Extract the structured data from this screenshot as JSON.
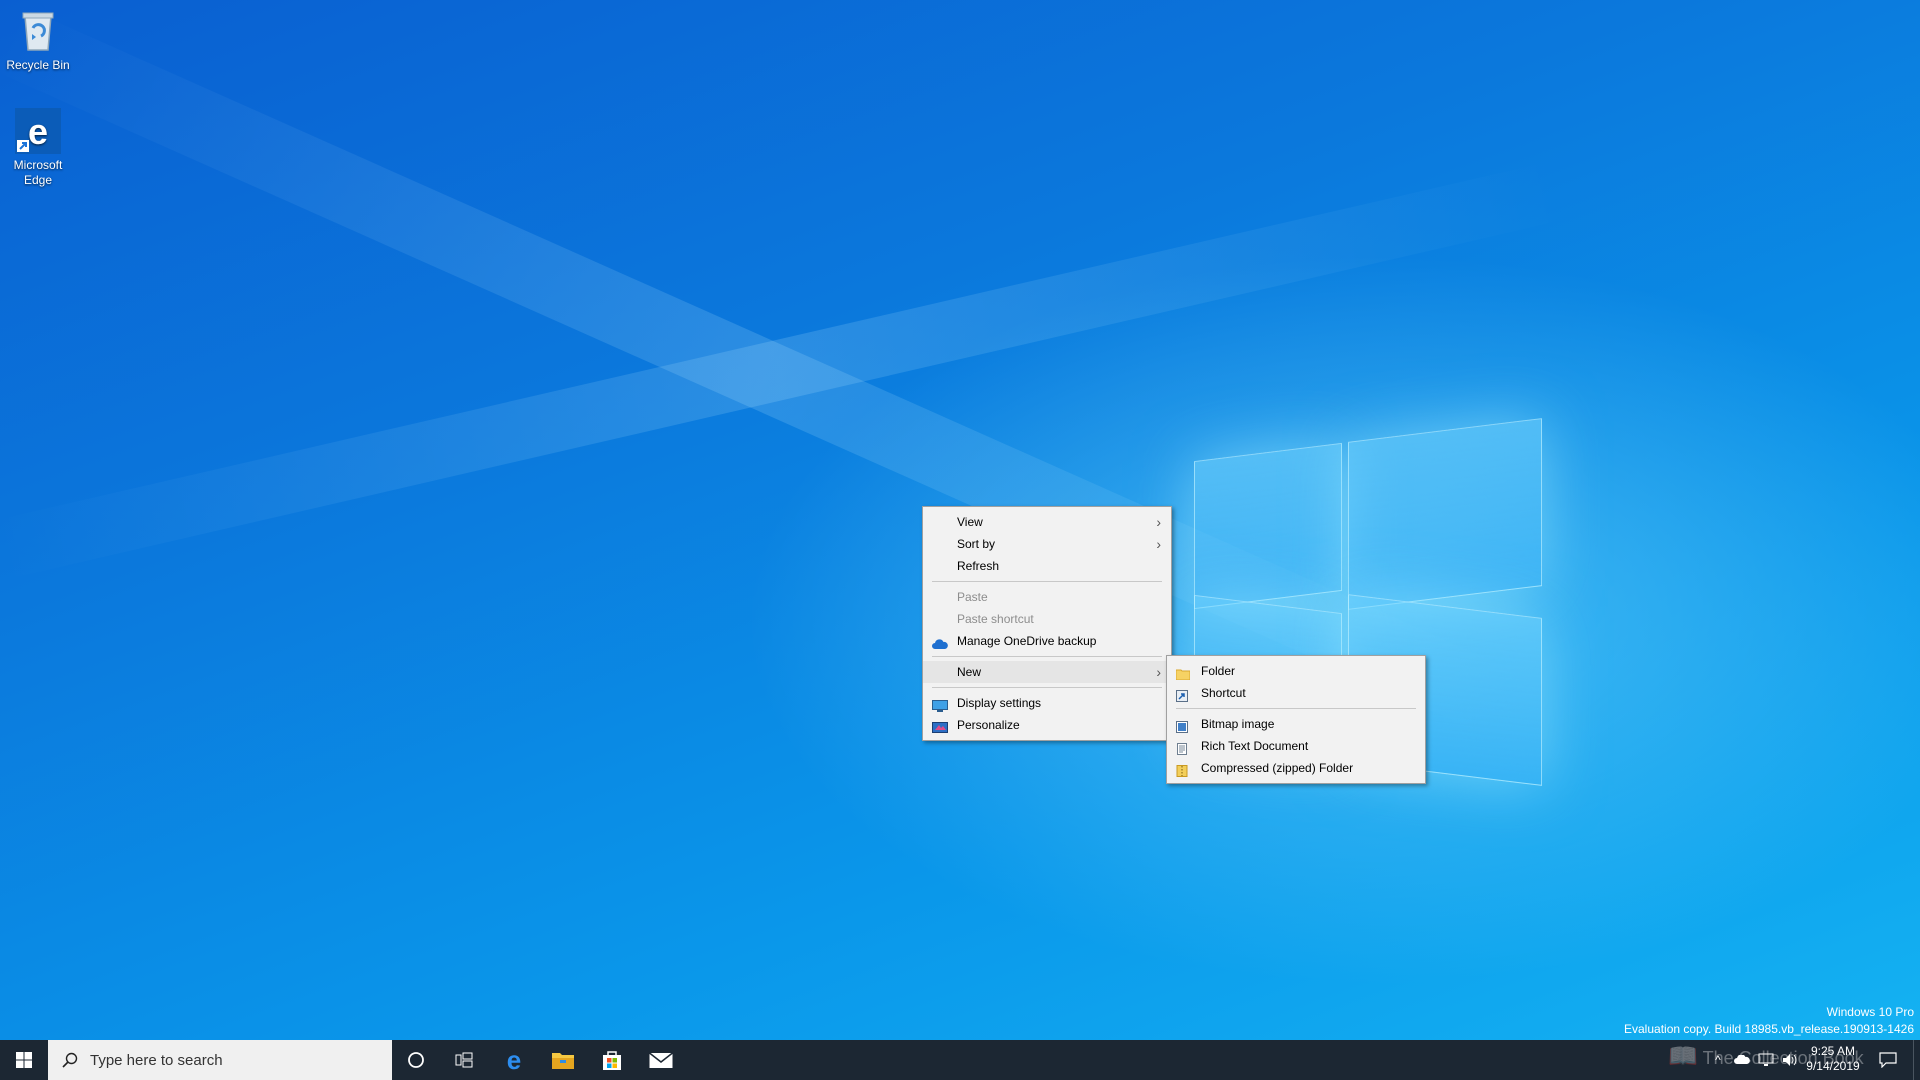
{
  "desktop": {
    "icons": [
      {
        "label": "Recycle Bin"
      },
      {
        "label": "Microsoft Edge"
      }
    ],
    "watermark": {
      "line1": "Windows 10 Pro",
      "line2": "Evaluation copy. Build 18985.vb_release.190913-1426"
    },
    "overlay_text": "The Collection Book"
  },
  "context_menu": {
    "items": [
      {
        "label": "View",
        "submenu": true
      },
      {
        "label": "Sort by",
        "submenu": true
      },
      {
        "label": "Refresh"
      },
      {
        "label": "Paste",
        "disabled": true
      },
      {
        "label": "Paste shortcut",
        "disabled": true
      },
      {
        "label": "Manage OneDrive backup",
        "icon": "onedrive-icon"
      },
      {
        "label": "New",
        "submenu": true
      },
      {
        "label": "Display settings",
        "icon": "display-settings-icon"
      },
      {
        "label": "Personalize",
        "icon": "personalize-icon"
      }
    ]
  },
  "new_submenu": {
    "items": [
      {
        "label": "Folder",
        "icon": "folder-icon"
      },
      {
        "label": "Shortcut",
        "icon": "shortcut-icon"
      },
      {
        "label": "Bitmap image",
        "icon": "bitmap-icon"
      },
      {
        "label": "Rich Text Document",
        "icon": "rtf-document-icon"
      },
      {
        "label": "Compressed (zipped) Folder",
        "icon": "zip-folder-icon"
      }
    ]
  },
  "taskbar": {
    "search_placeholder": "Type here to search",
    "pinned": [
      "cortana-icon",
      "task-view-icon",
      "edge-icon",
      "file-explorer-icon",
      "store-icon",
      "mail-icon"
    ],
    "clock": {
      "time": "9:25 AM",
      "date": "9/14/2019"
    }
  },
  "colors": {
    "taskbar": "#1c2733",
    "desktop_accent": "#0a76d8",
    "menu_bg": "#f2f2f2"
  }
}
